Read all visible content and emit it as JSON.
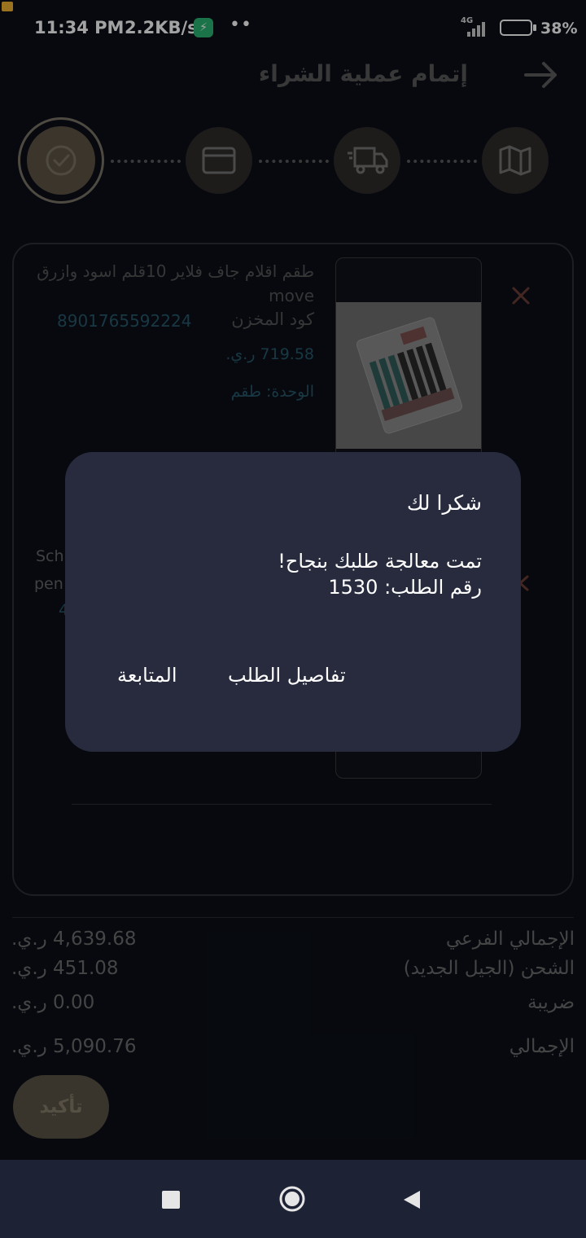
{
  "status_bar": {
    "time": "11:34 PM",
    "net_speed": "2.2KB/s",
    "network_type": "4G",
    "battery_percent": "38",
    "battery_level": 0.38
  },
  "header": {
    "title": "إتمام عملية الشراء",
    "back_icon": "arrow-right-icon"
  },
  "steps": [
    {
      "name": "address",
      "icon": "map-icon",
      "active": false
    },
    {
      "name": "shipping",
      "icon": "truck-icon",
      "active": false
    },
    {
      "name": "payment",
      "icon": "credit-card-icon",
      "active": false
    },
    {
      "name": "confirmation",
      "icon": "check-circle-icon",
      "active": true
    }
  ],
  "product": {
    "name": "طقم اقلام جاف فلاير 10قلم اسود وازرق move",
    "code_label": "كود المخزن",
    "code": "8901765592224",
    "price": "719.58 ر.ي.",
    "unit": "الوحدة: طقم"
  },
  "product2_fragments": {
    "line1": "Sch",
    "line2": "pen",
    "line3": "4"
  },
  "totals": {
    "subtotal_label": "الإجمالي الفرعي",
    "subtotal_value": "4,639.68 ر.ي.",
    "shipping_label": "الشحن (الجيل الجديد)",
    "shipping_value": "451.08 ر.ي.",
    "tax_label": "ضريبة",
    "tax_value": "0.00 ر.ي.",
    "total_label": "الإجمالي",
    "total_value": "5,090.76 ر.ي."
  },
  "confirm_button": "تأكيد",
  "dialog": {
    "title": "شكرا لك",
    "message_line1": "تمت معالجة طلبك بنجاح!",
    "message_line2": "رقم الطلب: 1530",
    "details_button": "تفاصيل الطلب",
    "continue_button": "المتابعة"
  },
  "colors": {
    "background": "#0b0f18",
    "dialog": "#272b3d",
    "accent_gold": "#8b7d62",
    "link_teal": "#3a8aa8",
    "navbar": "#1d2235"
  }
}
